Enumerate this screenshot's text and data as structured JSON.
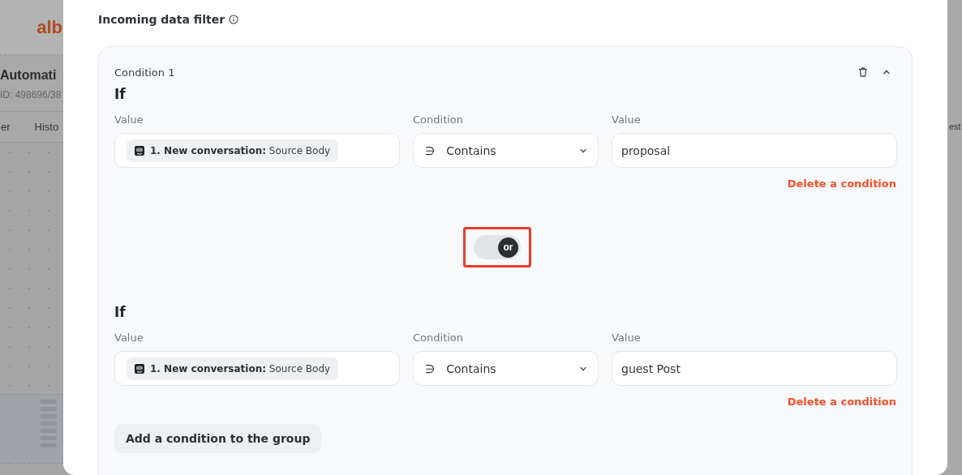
{
  "background": {
    "logo": "alb",
    "title": "Automati",
    "id": "ID: 498696/38",
    "tabs": [
      "er",
      "Histo"
    ],
    "right_tab": "est"
  },
  "modal": {
    "title": "Incoming data filter",
    "condition": {
      "title": "Condition 1",
      "expanded": true,
      "rules": [
        {
          "heading": "If",
          "value_label": "Value",
          "chip": {
            "step": "1. New conversation:",
            "field": "Source Body"
          },
          "condition_label": "Condition",
          "operator_symbol": "∋",
          "operator": "Contains",
          "value2_label": "Value",
          "value": "proposal",
          "delete": "Delete a condition"
        },
        {
          "heading": "If",
          "value_label": "Value",
          "chip": {
            "step": "1. New conversation:",
            "field": "Source Body"
          },
          "condition_label": "Condition",
          "operator_symbol": "∋",
          "operator": "Contains",
          "value2_label": "Value",
          "value": "guest Post",
          "delete": "Delete a condition"
        }
      ],
      "connector": {
        "label": "or",
        "on": true,
        "highlighted": true
      },
      "add_button": "Add a condition to the group"
    }
  }
}
